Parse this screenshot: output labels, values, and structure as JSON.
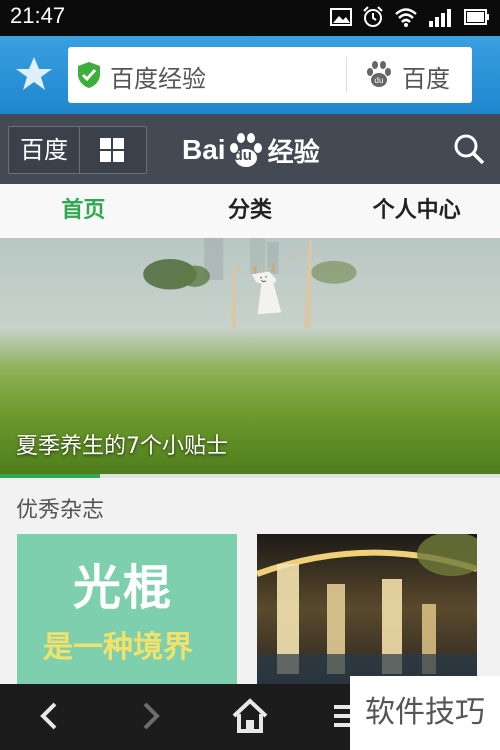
{
  "status_bar": {
    "time": "21:47"
  },
  "address_bar": {
    "url_text": "百度经验",
    "search_engine_label": "百度"
  },
  "site_header": {
    "home_button_label": "百度",
    "logo_text_bai": "Bai",
    "logo_text_du": "du",
    "logo_text_suffix": "经验"
  },
  "tabs": [
    {
      "label": "首页",
      "active": true
    },
    {
      "label": "分类",
      "active": false
    },
    {
      "label": "个人中心",
      "active": false
    }
  ],
  "hero": {
    "caption": "夏季养生的7个小贴士",
    "progress": 0.2
  },
  "magazines": {
    "section_title": "优秀杂志",
    "items": [
      {
        "line1": "光棍",
        "line2": "是一种境界"
      },
      {
        "line1": "",
        "line2": ""
      }
    ]
  },
  "watermark": "软件技巧",
  "colors": {
    "accent_green": "#2fa84f",
    "header_dark": "#434a54",
    "address_blue": "#2a92d8"
  },
  "icons": [
    "star-icon",
    "shield-icon",
    "paw-icon",
    "grid-icon",
    "search-icon",
    "back-icon",
    "forward-icon",
    "home-icon",
    "menu-icon"
  ]
}
